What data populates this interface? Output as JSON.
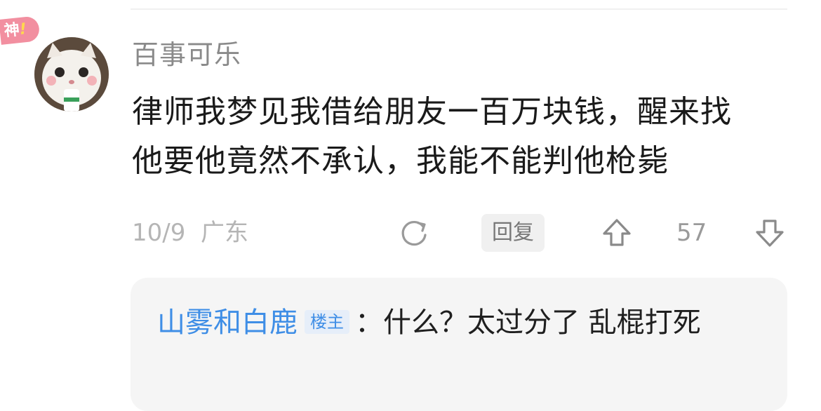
{
  "badge": {
    "label": "神",
    "accent": "!"
  },
  "comment": {
    "username": "百事可乐",
    "content_lines": [
      "律师我梦见我借给朋友一百万块钱，醒来找",
      "他要他竟然不承认，我能不能判他枪毙"
    ],
    "date": "10/9",
    "location": "广东",
    "reply_label": "回复",
    "vote_count": "57"
  },
  "sub_reply": {
    "author": "山雾和白鹿",
    "op_tag": "楼主",
    "separator": "：",
    "text": "什么？太过分了 乱棍打死"
  },
  "colors": {
    "link_blue": "#3f8ee6",
    "badge_pink": "#f28fa0",
    "meta_gray": "#b5b5b5"
  },
  "icons": {
    "share": "refresh-share-icon",
    "upvote": "up-arrow-icon",
    "downvote": "down-arrow-icon"
  }
}
